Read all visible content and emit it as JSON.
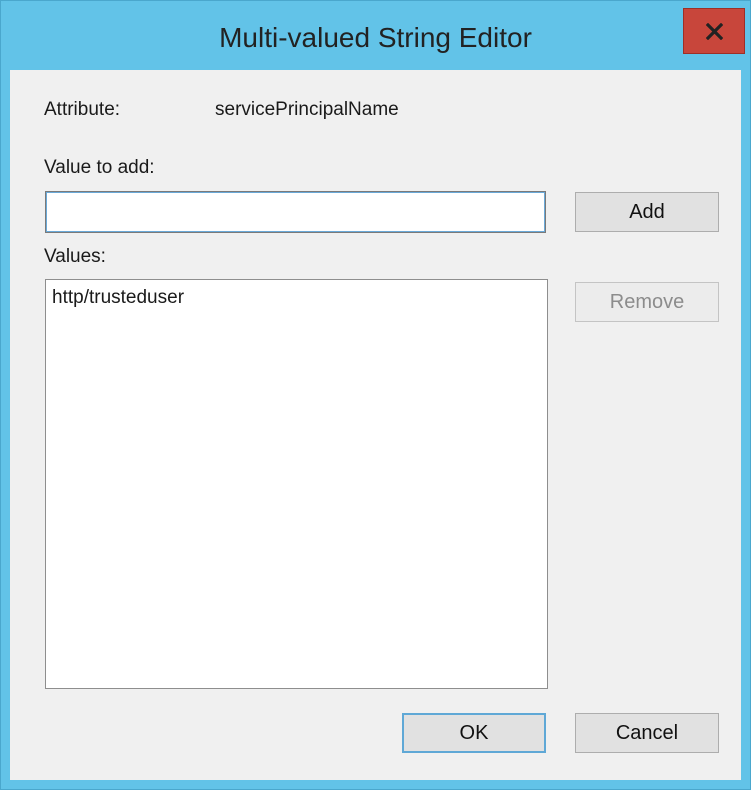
{
  "window": {
    "title": "Multi-valued String Editor",
    "close_icon": "close-icon",
    "close_label": "×"
  },
  "attribute": {
    "label": "Attribute:",
    "value": "servicePrincipalName"
  },
  "value_to_add": {
    "label": "Value to add:",
    "value": "",
    "placeholder": ""
  },
  "values": {
    "label": "Values:",
    "items": [
      "http/trusteduser"
    ]
  },
  "buttons": {
    "add": "Add",
    "remove": "Remove",
    "ok": "OK",
    "cancel": "Cancel"
  },
  "colors": {
    "titlebar": "#62c3e8",
    "close_button": "#c8463b",
    "client_bg": "#f0f0f0"
  }
}
